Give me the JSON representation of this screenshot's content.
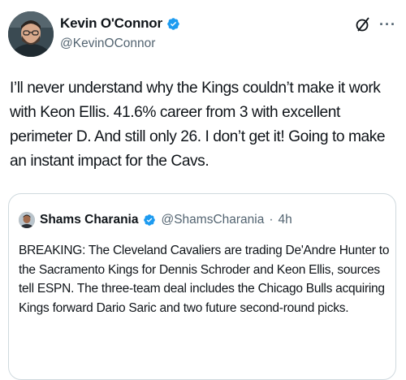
{
  "tweet": {
    "author": {
      "display_name": "Kevin O'Connor",
      "handle": "@KevinOConnor",
      "verified": true
    },
    "icons": {
      "verified": "verified-badge-icon",
      "grok": "grok-icon",
      "more": "more-icon"
    },
    "more_label": "···",
    "text": "I’ll never understand why the Kings couldn’t make it work with Keon Ellis. 41.6% career from 3 with excellent perimeter D. And still only 26. I don’t get it! Going to make an instant impact for the Cavs."
  },
  "quote": {
    "author": {
      "display_name": "Shams Charania",
      "handle": "@ShamsCharania",
      "verified": true
    },
    "separator": "·",
    "time": "4h",
    "text": "BREAKING: The Cleveland Cavaliers are trading De'Andre Hunter to the Sacramento Kings for Dennis Schroder and Keon Ellis, sources tell ESPN. The three-team deal includes the Chicago Bulls acquiring Kings forward Dario Saric and two future second-round picks."
  },
  "colors": {
    "text_primary": "#0f1419",
    "text_secondary": "#536471",
    "verified_blue": "#1d9bf0",
    "border": "#cfd9de"
  }
}
